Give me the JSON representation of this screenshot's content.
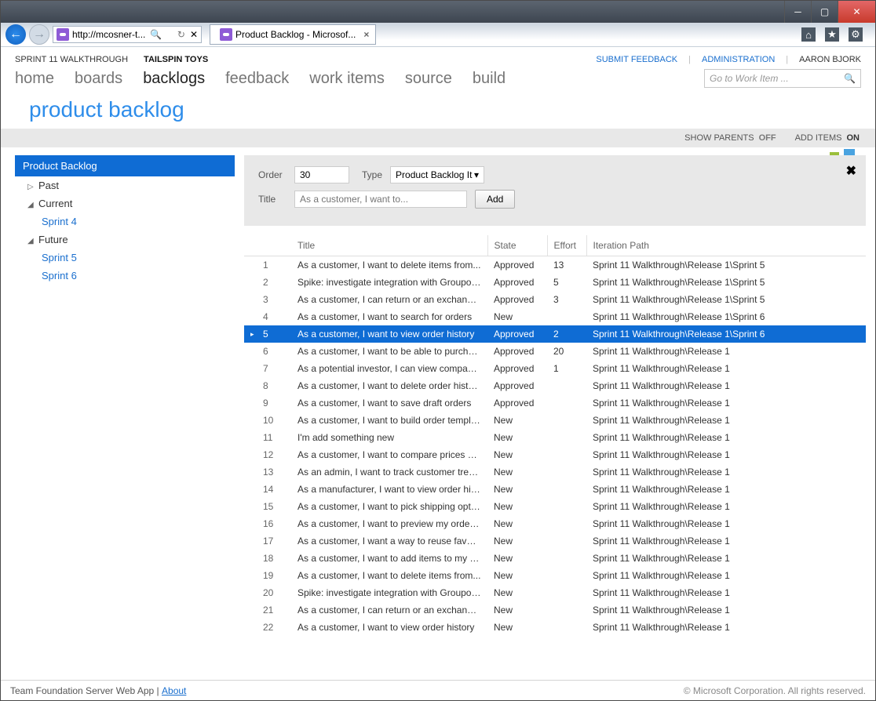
{
  "browser": {
    "url_display": "http://mcosner-t...",
    "tab_title": "Product Backlog - Microsof..."
  },
  "header": {
    "project_left": "SPRINT 11 WALKTHROUGH",
    "project_right": "TAILSPIN TOYS",
    "submit_feedback": "SUBMIT FEEDBACK",
    "administration": "ADMINISTRATION",
    "user": "AARON BJORK",
    "nav": [
      "home",
      "boards",
      "backlogs",
      "feedback",
      "work items",
      "source",
      "build"
    ],
    "nav_active": "backlogs",
    "search_placeholder": "Go to Work Item ...",
    "page_title": "product backlog",
    "toggles": {
      "show_parents_label": "SHOW PARENTS",
      "show_parents_value": "OFF",
      "add_items_label": "ADD ITEMS",
      "add_items_value": "ON"
    }
  },
  "tree": {
    "root": "Product Backlog",
    "past": "Past",
    "current": "Current",
    "current_children": [
      "Sprint 4"
    ],
    "future": "Future",
    "future_children": [
      "Sprint 5",
      "Sprint 6"
    ]
  },
  "add_form": {
    "order_label": "Order",
    "order_value": "30",
    "type_label": "Type",
    "type_value": "Product Backlog It",
    "title_label": "Title",
    "title_placeholder": "As a customer, I want to...",
    "button": "Add"
  },
  "grid": {
    "columns": [
      "Title",
      "State",
      "Effort",
      "Iteration Path"
    ],
    "selected_index": 4,
    "rows": [
      {
        "n": 1,
        "title": "As a customer, I want to delete items from...",
        "state": "Approved",
        "effort": "13",
        "path": "Sprint 11 Walkthrough\\Release 1\\Sprint 5"
      },
      {
        "n": 2,
        "title": "Spike: investigate integration with Groupon...",
        "state": "Approved",
        "effort": "5",
        "path": "Sprint 11 Walkthrough\\Release 1\\Sprint 5"
      },
      {
        "n": 3,
        "title": "As a customer, I can return or an exchange a...",
        "state": "Approved",
        "effort": "3",
        "path": "Sprint 11 Walkthrough\\Release 1\\Sprint 5"
      },
      {
        "n": 4,
        "title": "As a customer, I want to search for orders",
        "state": "New",
        "effort": "",
        "path": "Sprint 11 Walkthrough\\Release 1\\Sprint 6"
      },
      {
        "n": 5,
        "title": "As a customer, I want to view order history",
        "state": "Approved",
        "effort": "2",
        "path": "Sprint 11 Walkthrough\\Release 1\\Sprint 6"
      },
      {
        "n": 6,
        "title": "As a customer, I want to be able to purchase...",
        "state": "Approved",
        "effort": "20",
        "path": "Sprint 11 Walkthrough\\Release 1"
      },
      {
        "n": 7,
        "title": "As a potential investor, I can view company i...",
        "state": "Approved",
        "effort": "1",
        "path": "Sprint 11 Walkthrough\\Release 1"
      },
      {
        "n": 8,
        "title": "As a customer, I want to delete order history",
        "state": "Approved",
        "effort": "",
        "path": "Sprint 11 Walkthrough\\Release 1"
      },
      {
        "n": 9,
        "title": "As a customer, I want to save draft orders",
        "state": "Approved",
        "effort": "",
        "path": "Sprint 11 Walkthrough\\Release 1"
      },
      {
        "n": 10,
        "title": "As a customer, I want to build order templates",
        "state": "New",
        "effort": "",
        "path": "Sprint 11 Walkthrough\\Release 1"
      },
      {
        "n": 11,
        "title": "I'm add something new",
        "state": "New",
        "effort": "",
        "path": "Sprint 11 Walkthrough\\Release 1"
      },
      {
        "n": 12,
        "title": "As a customer, I want to compare prices with...",
        "state": "New",
        "effort": "",
        "path": "Sprint 11 Walkthrough\\Release 1"
      },
      {
        "n": 13,
        "title": "As an admin, I want to track customer trends",
        "state": "New",
        "effort": "",
        "path": "Sprint 11 Walkthrough\\Release 1"
      },
      {
        "n": 14,
        "title": "As a manufacturer, I want to view order histo...",
        "state": "New",
        "effort": "",
        "path": "Sprint 11 Walkthrough\\Release 1"
      },
      {
        "n": 15,
        "title": "As a customer, I want to pick shipping options",
        "state": "New",
        "effort": "",
        "path": "Sprint 11 Walkthrough\\Release 1"
      },
      {
        "n": 16,
        "title": "As a customer, I want to preview my order t...",
        "state": "New",
        "effort": "",
        "path": "Sprint 11 Walkthrough\\Release 1"
      },
      {
        "n": 17,
        "title": "As a customer, I want a way to reuse favorite...",
        "state": "New",
        "effort": "",
        "path": "Sprint 11 Walkthrough\\Release 1"
      },
      {
        "n": 18,
        "title": "As a customer, I want to add items to my cart",
        "state": "New",
        "effort": "",
        "path": "Sprint 11 Walkthrough\\Release 1"
      },
      {
        "n": 19,
        "title": "As a customer, I want to delete items from...",
        "state": "New",
        "effort": "",
        "path": "Sprint 11 Walkthrough\\Release 1"
      },
      {
        "n": 20,
        "title": "Spike: investigate integration with Groupon...",
        "state": "New",
        "effort": "",
        "path": "Sprint 11 Walkthrough\\Release 1"
      },
      {
        "n": 21,
        "title": "As a customer, I can return or an exchange a...",
        "state": "New",
        "effort": "",
        "path": "Sprint 11 Walkthrough\\Release 1"
      },
      {
        "n": 22,
        "title": "As a customer, I want to view order history",
        "state": "New",
        "effort": "",
        "path": "Sprint 11 Walkthrough\\Release 1"
      }
    ]
  },
  "footer": {
    "text": "Team Foundation Server Web App",
    "about": "About",
    "copyright": "© Microsoft Corporation. All rights reserved."
  }
}
